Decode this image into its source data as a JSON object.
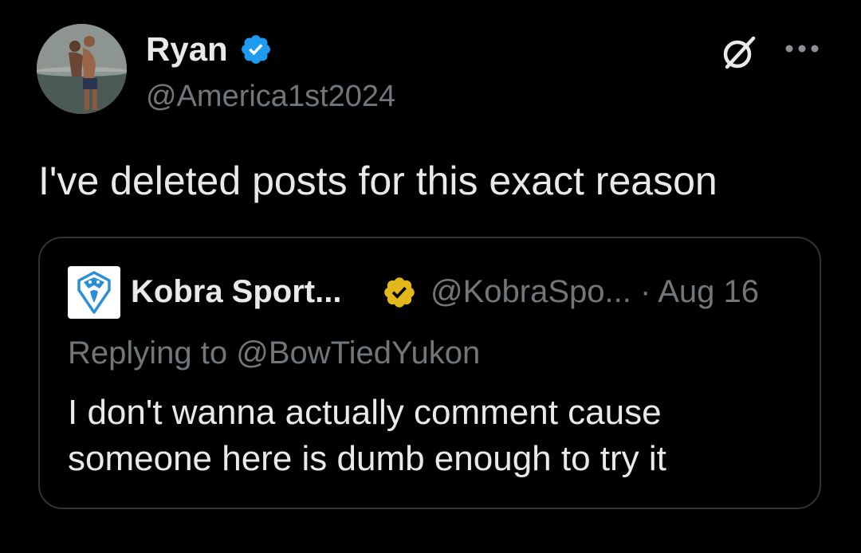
{
  "author": {
    "name": "Ryan",
    "handle": "@America1st2024",
    "avatar_icon": "profile-photo",
    "verified_color": "#1d9bf0"
  },
  "post": {
    "text": "I've deleted posts for this exact reason"
  },
  "quoted_post": {
    "name": "Kobra Sport...",
    "handle": "@KobraSpo...",
    "separator": "·",
    "date": "Aug 16",
    "replying_to": "Replying to @BowTiedYukon",
    "text": "I don't wanna actually comment cause someone here is dumb enough to try it",
    "verified_color": "#e2b719",
    "avatar_icon": "kobra-logo"
  },
  "icons": {
    "grok": "grok-icon",
    "more": "more-options-icon"
  },
  "colors": {
    "background": "#000000",
    "text": "#e7e9ea",
    "secondary": "#71767b",
    "border": "#2f3336"
  }
}
